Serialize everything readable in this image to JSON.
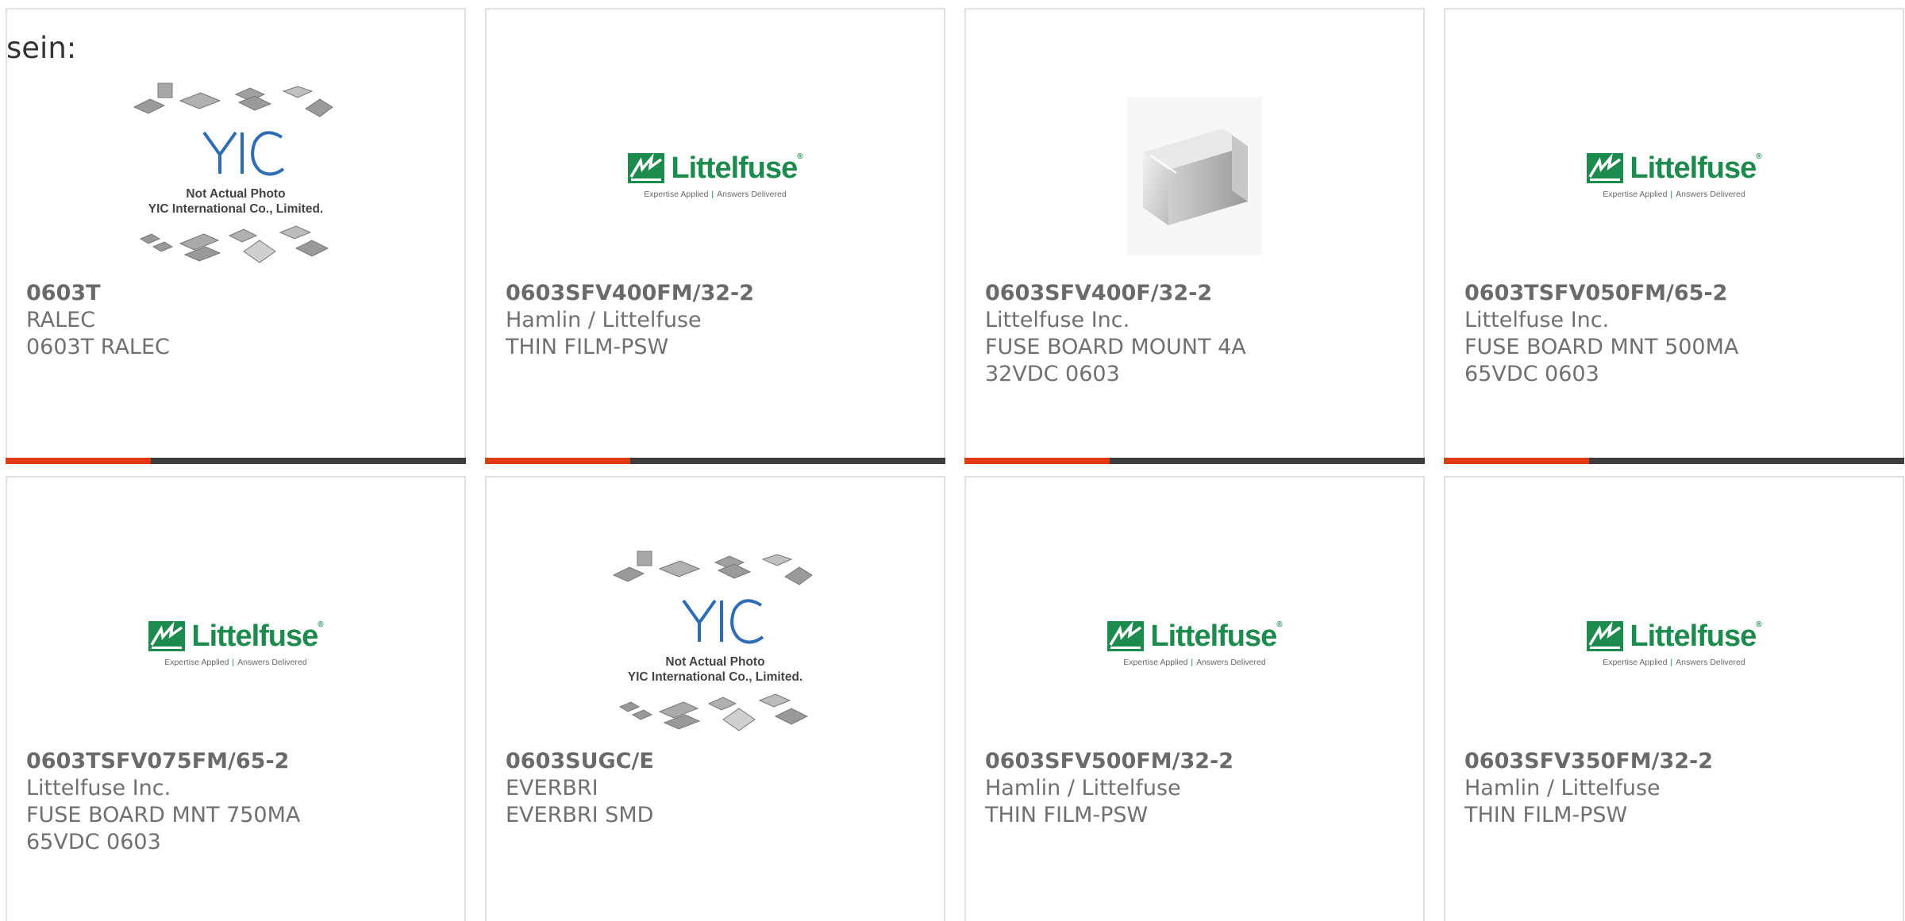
{
  "intro_text": "sein:",
  "logos": {
    "littelfuse": {
      "wordmark": "Littelfuse",
      "reg": "®",
      "tagline_left": "Expertise Applied",
      "tagline_sep": "|",
      "tagline_right": "Answers Delivered",
      "color": "#1d8a4e"
    },
    "yic": {
      "line1": "Not Actual Photo",
      "line2": "YIC International Co., Limited.",
      "color": "#2e6db3"
    }
  },
  "colors": {
    "accent": "#e23a0e",
    "bar": "#3d3d3d",
    "border": "#e2e2e2"
  },
  "products": [
    {
      "part_number": "0603T",
      "manufacturer": "RALEC",
      "description": "0603T RALEC",
      "image": "yic-placeholder"
    },
    {
      "part_number": "0603SFV400FM/32-2",
      "manufacturer": "Hamlin / Littelfuse",
      "description": "THIN FILM-PSW",
      "image": "littelfuse-logo"
    },
    {
      "part_number": "0603SFV400F/32-2",
      "manufacturer": "Littelfuse Inc.",
      "description": "FUSE BOARD MOUNT 4A 32VDC 0603",
      "image": "chip-photo"
    },
    {
      "part_number": "0603TSFV050FM/65-2",
      "manufacturer": "Littelfuse Inc.",
      "description": "FUSE BOARD MNT 500MA 65VDC 0603",
      "image": "littelfuse-logo"
    },
    {
      "part_number": "0603TSFV075FM/65-2",
      "manufacturer": "Littelfuse Inc.",
      "description": "FUSE BOARD MNT 750MA 65VDC 0603",
      "image": "littelfuse-logo"
    },
    {
      "part_number": "0603SUGC/E",
      "manufacturer": "EVERBRI",
      "description": "EVERBRI SMD",
      "image": "yic-placeholder"
    },
    {
      "part_number": "0603SFV500FM/32-2",
      "manufacturer": "Hamlin / Littelfuse",
      "description": "THIN FILM-PSW",
      "image": "littelfuse-logo"
    },
    {
      "part_number": "0603SFV350FM/32-2",
      "manufacturer": "Hamlin / Littelfuse",
      "description": "THIN FILM-PSW",
      "image": "littelfuse-logo"
    }
  ]
}
